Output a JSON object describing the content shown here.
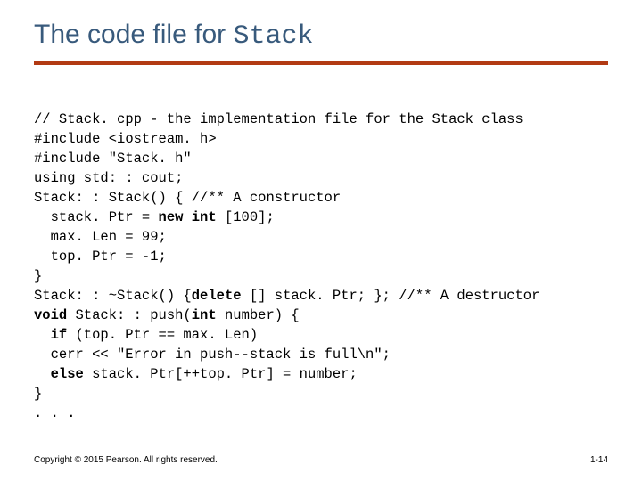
{
  "title": {
    "prefix": "The code file for ",
    "mono": "Stack"
  },
  "code": {
    "l1": "// Stack. cpp - the implementation file for the Stack class",
    "l2": "#include <iostream. h>",
    "l3": "#include \"Stack. h\"",
    "l4": "using std: : cout;",
    "l5": "Stack: : Stack() { //** A constructor",
    "l6a": "stack. Ptr = ",
    "l6b": "new int ",
    "l6c": "[100];",
    "l7": "max. Len = 99;",
    "l8": "top. Ptr = -1;",
    "l9": "}",
    "l10a": "Stack: : ~Stack() {",
    "l10b": "delete ",
    "l10c": "[] stack. Ptr; }; //** A destructor",
    "l11a": "void ",
    "l11b": "Stack: : push(",
    "l11c": "int ",
    "l11d": "number) {",
    "l12a": "if ",
    "l12b": "(top. Ptr == max. Len)",
    "l13": "cerr << \"Error in push--stack is full\\n\";",
    "l14a": "else ",
    "l14b": "stack. Ptr[++top. Ptr] = number;",
    "l15": "}",
    "l16": ". . ."
  },
  "footer": {
    "left": "Copyright © 2015 Pearson. All rights reserved.",
    "right": "1-14"
  }
}
